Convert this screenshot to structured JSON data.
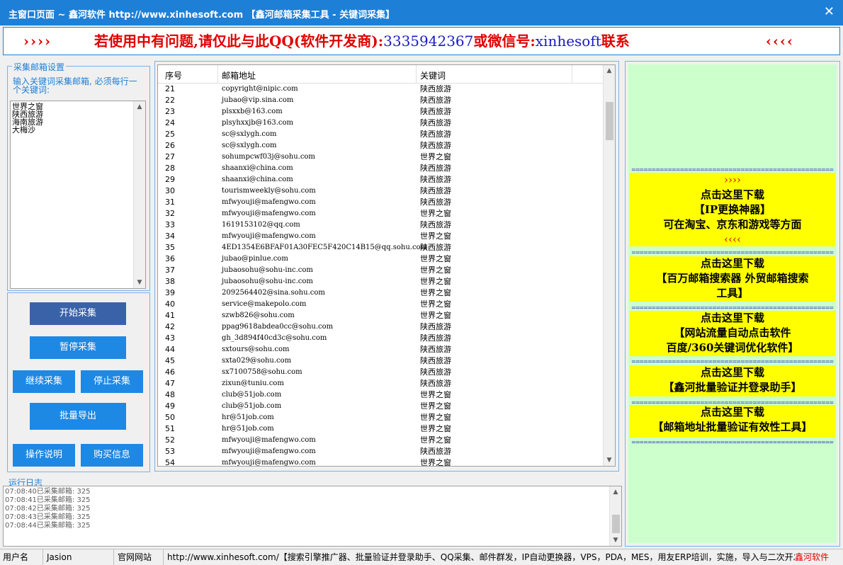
{
  "window": {
    "title": "主窗口页面 ~ 鑫河软件 http://www.xinhesoft.com 【鑫河邮箱采集工具 - 关键词采集】",
    "close_glyph": "✕"
  },
  "banner": {
    "left_arrows": "››››",
    "message_red_1": "若使用中有问题,请仅此与此QQ(软件开发商):",
    "qq": "3335942367",
    "message_red_2": "或微信号:",
    "wechat": "xinhesoft",
    "message_red_3": "联系",
    "right_arrows": "‹‹‹‹"
  },
  "settings": {
    "legend": "采集邮箱设置",
    "hint": "输入关键词采集邮箱, 必须每行一个关键词:",
    "keywords": [
      "世界之窗",
      "陕西旅游",
      "海南旅游",
      "大梅沙"
    ]
  },
  "buttons": {
    "start": "开始采集",
    "pause": "暂停采集",
    "continue": "继续采集",
    "stop": "停止采集",
    "export": "批量导出",
    "help": "操作说明",
    "buy": "购买信息"
  },
  "table": {
    "headers": [
      "序号",
      "邮箱地址",
      "关键词"
    ],
    "rows": [
      [
        "21",
        "copyright@nipic.com",
        "陕西旅游"
      ],
      [
        "22",
        "jubao@vip.sina.com",
        "陕西旅游"
      ],
      [
        "23",
        "plsxxb@163.com",
        "陕西旅游"
      ],
      [
        "24",
        "plsyhxxjb@163.com",
        "陕西旅游"
      ],
      [
        "25",
        "sc@sxlygh.com",
        "陕西旅游"
      ],
      [
        "26",
        "sc@sxlygh.com",
        "陕西旅游"
      ],
      [
        "27",
        "sohumpcwf03j@sohu.com",
        "世界之窗"
      ],
      [
        "28",
        "shaanxi@china.com",
        "陕西旅游"
      ],
      [
        "29",
        "shaanxi@china.com",
        "陕西旅游"
      ],
      [
        "30",
        "tourismweekly@sohu.com",
        "陕西旅游"
      ],
      [
        "31",
        "mfwyouji@mafengwo.com",
        "陕西旅游"
      ],
      [
        "32",
        "mfwyouji@mafengwo.com",
        "世界之窗"
      ],
      [
        "33",
        "1619153102@qq.com",
        "陕西旅游"
      ],
      [
        "34",
        "mfwyouji@mafengwo.com",
        "世界之窗"
      ],
      [
        "35",
        "4ED1354E6BFAF01A30FEC5F420C14B15@qq.sohu.com",
        "陕西旅游"
      ],
      [
        "36",
        "jubao@pinlue.com",
        "世界之窗"
      ],
      [
        "37",
        "jubaosohu@sohu-inc.com",
        "世界之窗"
      ],
      [
        "38",
        "jubaosohu@sohu-inc.com",
        "世界之窗"
      ],
      [
        "39",
        "2092564402@sina.sohu.com",
        "世界之窗"
      ],
      [
        "40",
        "service@makepolo.com",
        "世界之窗"
      ],
      [
        "41",
        "szwb826@sohu.com",
        "世界之窗"
      ],
      [
        "42",
        "ppag9618abdea0cc@sohu.com",
        "陕西旅游"
      ],
      [
        "43",
        "gh_3d894f40cd3c@sohu.com",
        "陕西旅游"
      ],
      [
        "44",
        "sxtours@sohu.com",
        "陕西旅游"
      ],
      [
        "45",
        "sxta029@sohu.com",
        "陕西旅游"
      ],
      [
        "46",
        "sx7100758@sohu.com",
        "陕西旅游"
      ],
      [
        "47",
        "zixun@tuniu.com",
        "陕西旅游"
      ],
      [
        "48",
        "club@51job.com",
        "世界之窗"
      ],
      [
        "49",
        "club@51job.com",
        "世界之窗"
      ],
      [
        "50",
        "hr@51job.com",
        "世界之窗"
      ],
      [
        "51",
        "hr@51job.com",
        "世界之窗"
      ],
      [
        "52",
        "mfwyouji@mafengwo.com",
        "世界之窗"
      ],
      [
        "53",
        "mfwyouji@mafengwo.com",
        "陕西旅游"
      ],
      [
        "54",
        "mfwyouji@mafengwo.com",
        "世界之窗"
      ]
    ]
  },
  "ads": {
    "dashes": "================================================================",
    "ad1": {
      "top_arrows": "››››",
      "line1": "点击这里下载",
      "line2": "【IP更换神器】",
      "line3": "可在淘宝、京东和游戏等方面",
      "bottom_arrows": "‹‹‹‹"
    },
    "ad2": {
      "line1": "点击这里下载",
      "line2": "【百万邮箱搜索器 外贸邮箱搜索",
      "line3": "工具】"
    },
    "ad3": {
      "line1": "点击这里下载",
      "line2": "【网站流量自动点击软件",
      "line3": "百度/360关键词优化软件】"
    },
    "ad4": {
      "line1": "点击这里下载",
      "line2": "【鑫河批量验证并登录助手】"
    },
    "ad5": {
      "line1": "点击这里下载",
      "line2": "【邮箱地址批量验证有效性工具】"
    }
  },
  "log": {
    "legend": "运行日志",
    "lines": [
      "07:08:40已采集邮箱: 325",
      "07:08:41已采集邮箱: 325",
      "07:08:42已采集邮箱: 325",
      "07:08:43已采集邮箱: 325",
      "07:08:44已采集邮箱: 325"
    ]
  },
  "status": {
    "user_label": "用户名",
    "user_value": "Jasion",
    "site_label": "官网网站",
    "site_text": "http://www.xinhesoft.com/【搜索引擎推广器、批量验证并登录助手、QQ采集、邮件群发，IP自动更换器，VPS，PDA，MES，用友ERP培训，实施，导入与二次开发",
    "brand": "鑫河软件"
  },
  "colors": {
    "titlebar": "#1e7fd6",
    "accent": "#1e88e5",
    "ad_yellow": "#ffff00",
    "ad_green": "#ccffcc",
    "alert_red": "#e00000"
  }
}
